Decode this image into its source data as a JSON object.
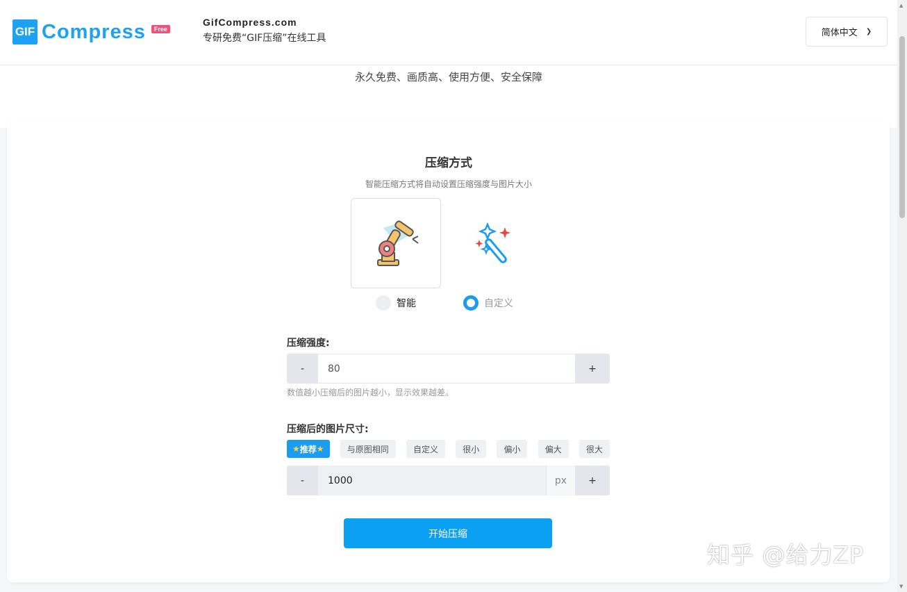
{
  "header": {
    "logo_mark": "GIF",
    "logo_word": "Compress",
    "logo_badge": "Free",
    "site_domain": "GifCompress.com",
    "site_tagline": "专研免费“GIF压缩”在线工具",
    "language": "简体中文"
  },
  "slogan": "永久免费、画质高、使用方便、安全保障",
  "mode": {
    "title": "压缩方式",
    "description": "智能压缩方式将自动设置压缩强度与图片大小",
    "options": [
      {
        "label": "智能",
        "icon": "robot-arm-icon",
        "checked": false
      },
      {
        "label": "自定义",
        "icon": "magic-wand-icon",
        "checked": true
      }
    ]
  },
  "strength": {
    "label": "压缩强度:",
    "minus": "-",
    "value": "80",
    "plus": "+",
    "hint": "数值越小压缩后的图片越小，显示效果越差。"
  },
  "size": {
    "label": "压缩后的图片尺寸:",
    "presets": [
      "推荐",
      "与原图相同",
      "自定义",
      "很小",
      "偏小",
      "偏大",
      "很大"
    ],
    "minus": "-",
    "value": "1000",
    "unit": "px",
    "plus": "+"
  },
  "start_button": "开始压缩",
  "watermark": "知乎 @给力ZP",
  "colors": {
    "accent": "#0ca0f2",
    "badge": "#f0507a",
    "star": "#ffd24a"
  }
}
